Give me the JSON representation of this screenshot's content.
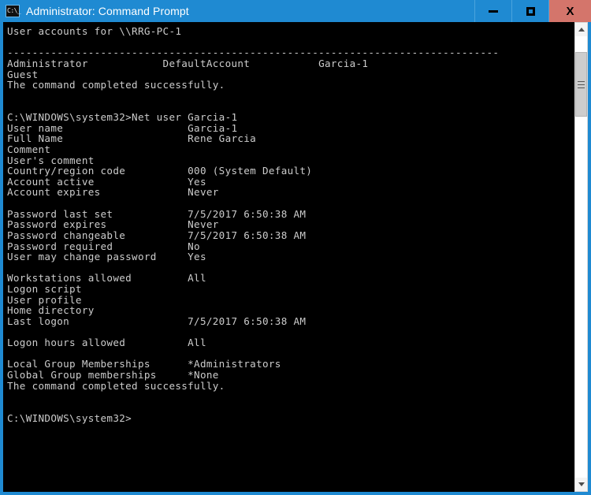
{
  "window": {
    "title": "Administrator: Command Prompt",
    "icon": "cmd-icon",
    "icon_glyph": "C:\\_",
    "accent_color": "#1f8ad2",
    "close_button_color": "#d4756b",
    "console_bg": "#000000",
    "console_fg": "#cccccc"
  },
  "titlebar_buttons": {
    "minimize": "minimize-button",
    "maximize": "restore-button",
    "close_label": "X"
  },
  "scrollbar": {
    "up_arrow": "scroll-up-arrow",
    "down_arrow": "scroll-down-arrow",
    "thumb": "scrollbar-thumb"
  },
  "console": {
    "lines": [
      "User accounts for \\\\RRG-PC-1",
      "",
      "-------------------------------------------------------------------------------",
      "Administrator            DefaultAccount           Garcia-1",
      "Guest",
      "The command completed successfully.",
      "",
      "",
      "C:\\WINDOWS\\system32>Net user Garcia-1",
      "User name                    Garcia-1",
      "Full Name                    Rene Garcia",
      "Comment",
      "User's comment",
      "Country/region code          000 (System Default)",
      "Account active               Yes",
      "Account expires              Never",
      "",
      "Password last set            7/5/2017 6:50:38 AM",
      "Password expires             Never",
      "Password changeable          7/5/2017 6:50:38 AM",
      "Password required            No",
      "User may change password     Yes",
      "",
      "Workstations allowed         All",
      "Logon script",
      "User profile",
      "Home directory",
      "Last logon                   7/5/2017 6:50:38 AM",
      "",
      "Logon hours allowed          All",
      "",
      "Local Group Memberships      *Administrators",
      "Global Group memberships     *None",
      "The command completed successfully.",
      "",
      "",
      "C:\\WINDOWS\\system32>"
    ]
  }
}
